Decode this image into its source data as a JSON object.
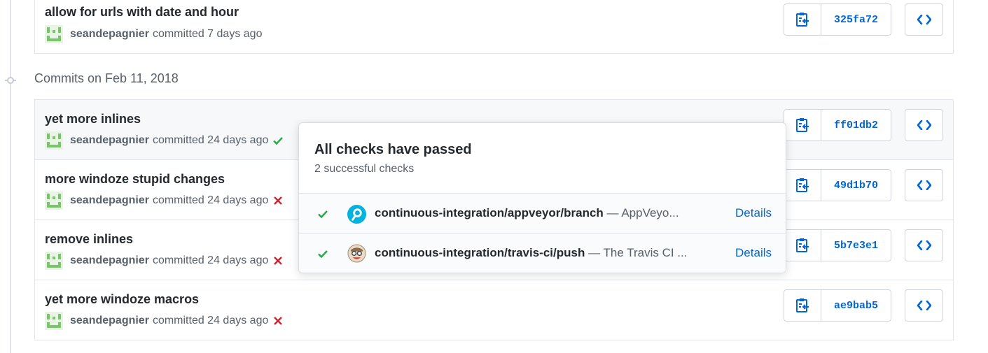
{
  "colors": {
    "link": "#0366d6",
    "success": "#28a745",
    "failure": "#cb2431",
    "muted": "#586069",
    "avatar_green": "#7ac46c"
  },
  "commits_top": [
    {
      "title": "allow for urls with date and hour",
      "author": "seandepagnier",
      "meta": "committed 7 days ago",
      "status": "none",
      "sha": "325fa72"
    }
  ],
  "date_heading": "Commits on Feb 11, 2018",
  "commits": [
    {
      "title": "yet more inlines",
      "author": "seandepagnier",
      "meta": "committed 24 days ago",
      "status": "success",
      "sha": "ff01db2"
    },
    {
      "title": "more windoze stupid changes",
      "author": "seandepagnier",
      "meta": "committed 24 days ago",
      "status": "failure",
      "sha": "49d1b70"
    },
    {
      "title": "remove inlines",
      "author": "seandepagnier",
      "meta": "committed 24 days ago",
      "status": "failure",
      "sha": "5b7e3e1"
    },
    {
      "title": "yet more windoze macros",
      "author": "seandepagnier",
      "meta": "committed 24 days ago",
      "status": "failure",
      "sha": "ae9bab5"
    }
  ],
  "popover": {
    "title": "All checks have passed",
    "subtitle": "2 successful checks",
    "checks": [
      {
        "name": "continuous-integration/appveyor/branch",
        "description": "— AppVeyo...",
        "details_label": "Details",
        "icon": "appveyor-logo-icon"
      },
      {
        "name": "continuous-integration/travis-ci/push",
        "description": "— The Travis CI ...",
        "details_label": "Details",
        "icon": "travis-ci-logo-icon"
      }
    ]
  }
}
